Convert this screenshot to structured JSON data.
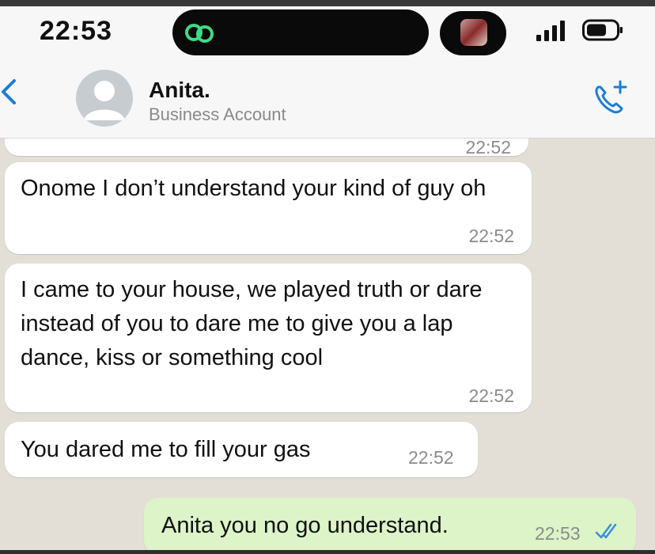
{
  "status_bar": {
    "time": "22:53"
  },
  "header": {
    "contact_name": "Anita.",
    "contact_subtitle": "Business Account"
  },
  "messages": [
    {
      "direction": "incoming",
      "text": "",
      "time": "22:52"
    },
    {
      "direction": "incoming",
      "text": "Onome I don’t understand your kind of guy oh",
      "time": "22:52"
    },
    {
      "direction": "incoming",
      "text": "I came to your house, we played truth or dare instead of you to dare me to give you a lap dance, kiss or something cool",
      "time": "22:52"
    },
    {
      "direction": "incoming",
      "text": "You dared me to fill your gas",
      "time": "22:52"
    },
    {
      "direction": "outgoing",
      "text": "Anita you no go understand.",
      "time": "22:53",
      "status": "read"
    }
  ],
  "colors": {
    "chat_background": "#e3ded6",
    "incoming_bubble": "#ffffff",
    "outgoing_bubble": "#dcf4c8",
    "accent": "#1b7dd6",
    "read_ticks": "#3b8fd9"
  },
  "icons": [
    "link-icon",
    "signal-icon",
    "battery-icon",
    "back-chevron-icon",
    "avatar-placeholder-icon",
    "add-call-icon",
    "read-ticks-icon"
  ]
}
